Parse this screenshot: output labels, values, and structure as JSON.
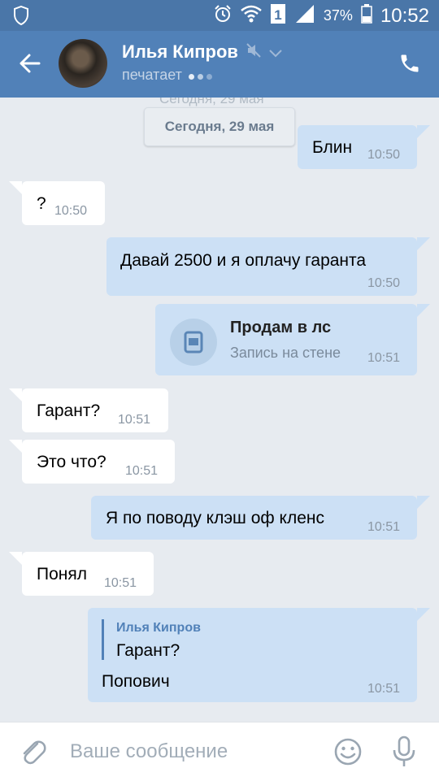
{
  "status": {
    "percent": "37%",
    "time": "10:52"
  },
  "header": {
    "name": "Илья Кипров",
    "subtitle": "печатает"
  },
  "chat": {
    "date_ghost": "Сегодня, 29 мая",
    "date": "Сегодня, 29 мая",
    "messages": [
      {
        "dir": "out",
        "text": "Блин",
        "time": "10:50"
      },
      {
        "dir": "in",
        "text": "?",
        "time": "10:50"
      },
      {
        "dir": "out",
        "text": "Давай 2500 и я оплачу гаранта",
        "time": "10:50"
      },
      {
        "dir": "out",
        "wall_title": "Продам в лс",
        "wall_sub": "Запись на стене",
        "time": "10:51"
      },
      {
        "dir": "in",
        "text": "Гарант?",
        "time": "10:51"
      },
      {
        "dir": "in",
        "text": "Это что?",
        "time": "10:51"
      },
      {
        "dir": "out",
        "text": "Я по поводу клэш оф кленс",
        "time": "10:51"
      },
      {
        "dir": "in",
        "text": "Понял",
        "time": "10:51"
      },
      {
        "dir": "out",
        "quote_author": "Илья Кипров",
        "quote_text": "Гарант?",
        "text": "Попович",
        "time": "10:51"
      }
    ]
  },
  "composer": {
    "placeholder": "Ваше сообщение"
  },
  "icons": [
    "shield-icon",
    "alarm-icon",
    "wifi-icon",
    "sim-icon",
    "signal-icon",
    "battery-icon",
    "back-arrow-icon",
    "mute-icon",
    "chevron-down-icon",
    "phone-icon",
    "wall-post-icon",
    "paperclip-icon",
    "smile-icon",
    "mic-icon"
  ],
  "colors": {
    "header": "#5181b8",
    "statusbar": "#4a76a8",
    "outgoing": "#cce0f5",
    "incoming": "#ffffff",
    "background": "#e7ebf0"
  }
}
